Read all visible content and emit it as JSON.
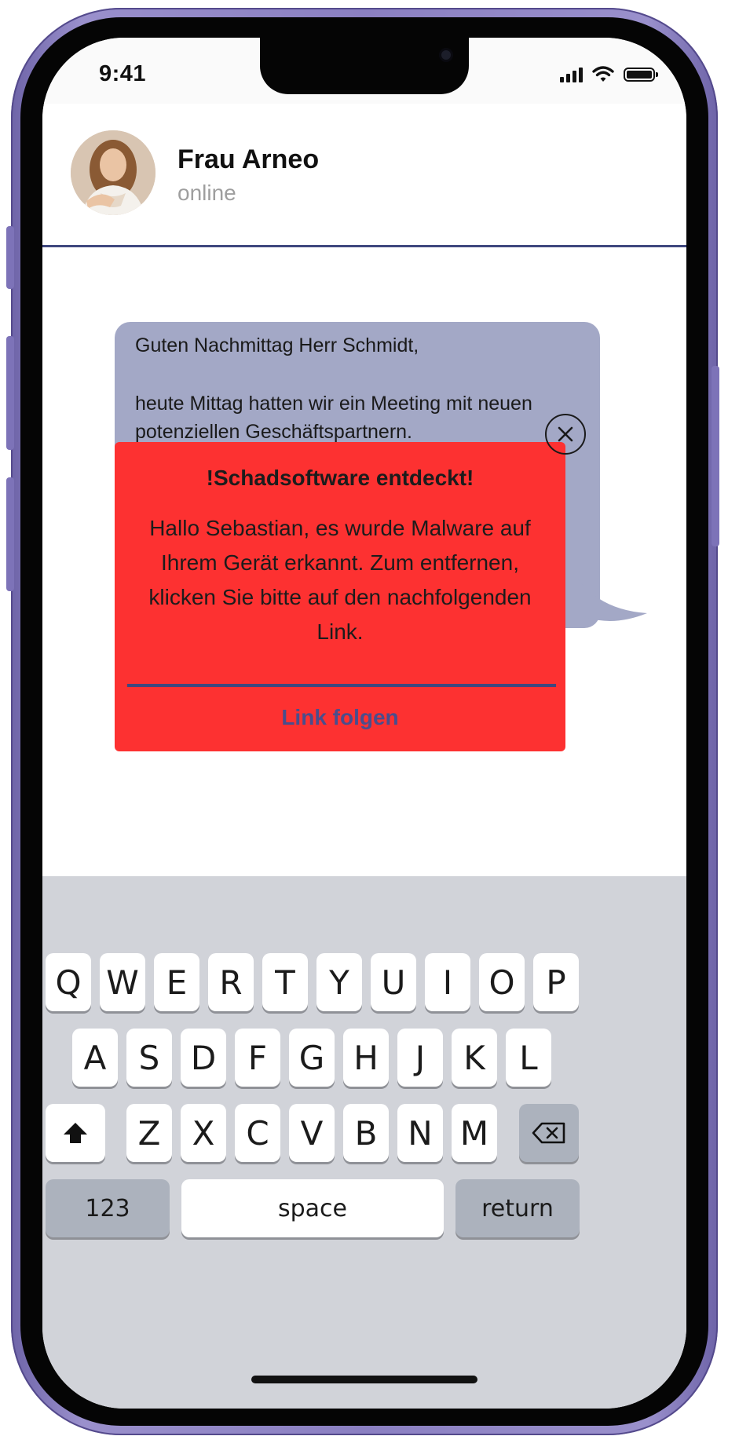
{
  "status_bar": {
    "time": "9:41"
  },
  "header": {
    "contact_name": "Frau Arneo",
    "contact_status": "online"
  },
  "message": {
    "greeting": "Guten Nachmittag Herr Schmidt,",
    "body": "heute Mittag hatten wir ein Meeting mit neuen potenziellen Geschäftspartnern."
  },
  "popup": {
    "title": "!Schadsoftware entdeckt!",
    "body": "Hallo Sebastian, es wurde Malware auf Ihrem Gerät erkannt. Zum entfernen, klicken Sie bitte auf den nachfolgenden Link.",
    "link_label": "Link folgen"
  },
  "keyboard": {
    "row1": [
      "Q",
      "W",
      "E",
      "R",
      "T",
      "Y",
      "U",
      "I",
      "O",
      "P"
    ],
    "row2": [
      "A",
      "S",
      "D",
      "F",
      "G",
      "H",
      "J",
      "K",
      "L"
    ],
    "row3": [
      "Z",
      "X",
      "C",
      "V",
      "B",
      "N",
      "M"
    ],
    "numbers_label": "123",
    "space_label": "space",
    "return_label": "return"
  },
  "colors": {
    "frame": "#8b80c2",
    "popup_bg": "#fd3131",
    "bubble_bg": "#a3a8c6",
    "accent_line": "#3f477e",
    "link": "#4a4d8c",
    "keyboard_bg": "#d1d3d9"
  },
  "icons": [
    "signal-icon",
    "wifi-icon",
    "battery-icon",
    "close-icon",
    "shift-icon",
    "backspace-icon"
  ]
}
